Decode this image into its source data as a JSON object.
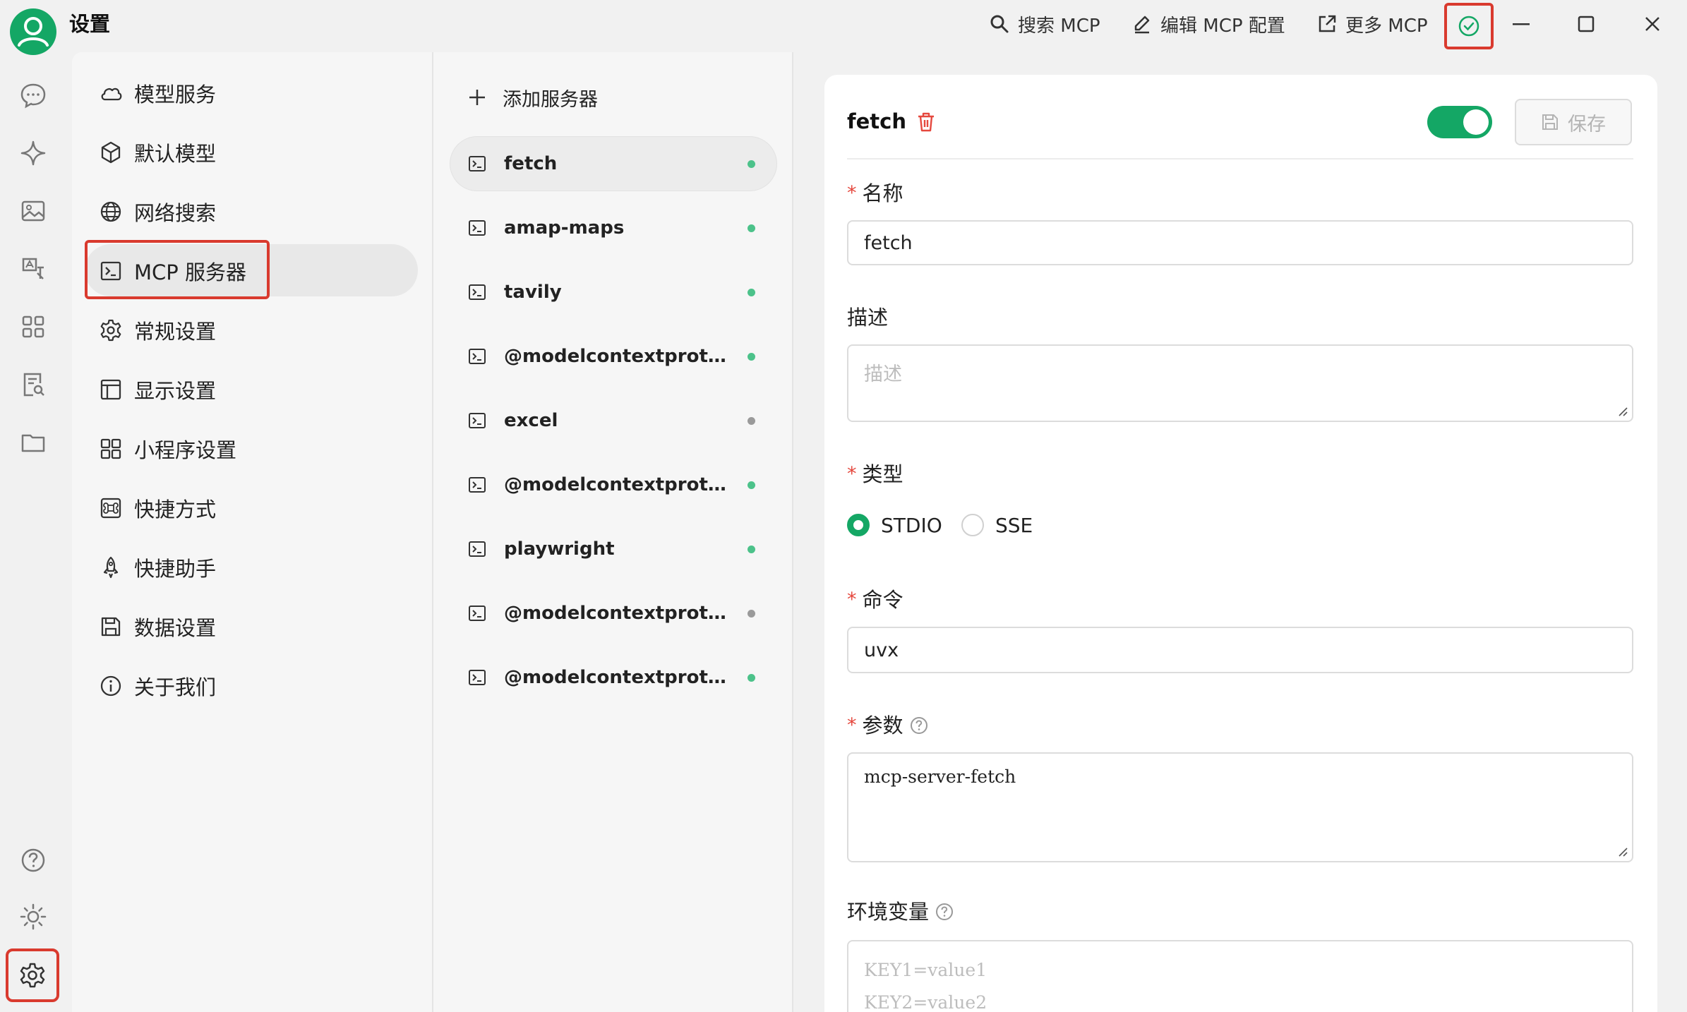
{
  "window": {
    "title": "设置",
    "actions": {
      "search_mcp": "搜索 MCP",
      "edit_mcp_config": "编辑 MCP 配置",
      "more_mcp": "更多 MCP"
    }
  },
  "nav": {
    "items": [
      {
        "label": "模型服务",
        "icon": "cloud-icon"
      },
      {
        "label": "默认模型",
        "icon": "cube-icon"
      },
      {
        "label": "网络搜索",
        "icon": "globe-icon"
      },
      {
        "label": "MCP 服务器",
        "icon": "terminal-icon"
      },
      {
        "label": "常规设置",
        "icon": "gear-icon"
      },
      {
        "label": "显示设置",
        "icon": "layout-icon"
      },
      {
        "label": "小程序设置",
        "icon": "grid-icon"
      },
      {
        "label": "快捷方式",
        "icon": "command-icon"
      },
      {
        "label": "快捷助手",
        "icon": "rocket-icon"
      },
      {
        "label": "数据设置",
        "icon": "save-icon"
      },
      {
        "label": "关于我们",
        "icon": "info-icon"
      }
    ],
    "active_index": 3
  },
  "servers": {
    "add_label": "添加服务器",
    "items": [
      {
        "name": "fetch",
        "status": "active"
      },
      {
        "name": "amap-maps",
        "status": "active"
      },
      {
        "name": "tavily",
        "status": "active"
      },
      {
        "name": "@modelcontextprotoco...",
        "status": "active"
      },
      {
        "name": "excel",
        "status": "inactive"
      },
      {
        "name": "@modelcontextprotoco...",
        "status": "active"
      },
      {
        "name": "playwright",
        "status": "active"
      },
      {
        "name": "@modelcontextprotoco...",
        "status": "inactive"
      },
      {
        "name": "@modelcontextprotoco...",
        "status": "active"
      }
    ],
    "selected_index": 0
  },
  "detail": {
    "title": "fetch",
    "enabled": true,
    "save_label": "保存",
    "name_label": "名称",
    "name_value": "fetch",
    "desc_label": "描述",
    "desc_placeholder": "描述",
    "type_label": "类型",
    "type_options": [
      "STDIO",
      "SSE"
    ],
    "type_selected": "STDIO",
    "command_label": "命令",
    "command_value": "uvx",
    "args_label": "参数",
    "args_value": "mcp-server-fetch",
    "env_label": "环境变量",
    "env_placeholder_line1": "KEY1=value1",
    "env_placeholder_line2": "KEY2=value2"
  },
  "colors": {
    "accent": "#14a765",
    "status_active": "#4cc28a",
    "status_inactive": "#9a9a9a",
    "highlight_box": "#d93a2e",
    "required": "#e5483e"
  }
}
